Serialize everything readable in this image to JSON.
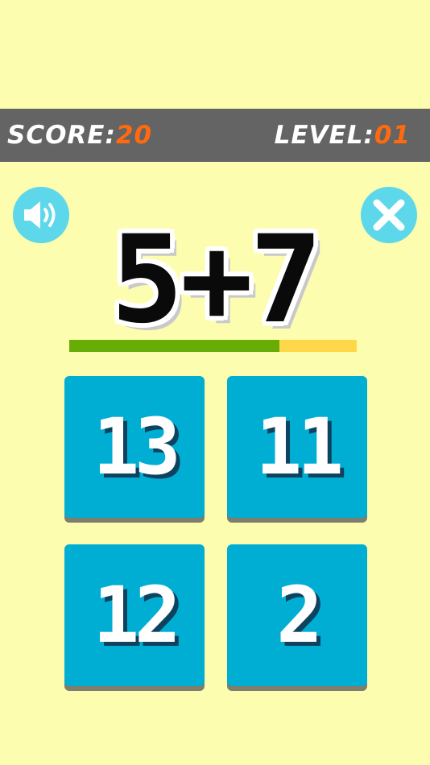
{
  "hud": {
    "score_label": "SCORE:",
    "score_value": "20",
    "level_label": "LEVEL:",
    "level_value": "01"
  },
  "buttons": {
    "sound_icon": "speaker-icon",
    "close_icon": "close-icon"
  },
  "question": {
    "text": "5+7"
  },
  "timer": {
    "remaining_fraction": 0.73
  },
  "answers": [
    {
      "label": "13"
    },
    {
      "label": "11"
    },
    {
      "label": "12"
    },
    {
      "label": "2"
    }
  ],
  "colors": {
    "background": "#fdfdb0",
    "topbar": "#646464",
    "hud_value": "#ff6a0e",
    "round_button": "#5dd7ea",
    "answer_tile": "#00aed4",
    "answer_shadow": "#0e4360",
    "timer_fill": "#67ad06",
    "timer_track": "#ffd84a"
  }
}
